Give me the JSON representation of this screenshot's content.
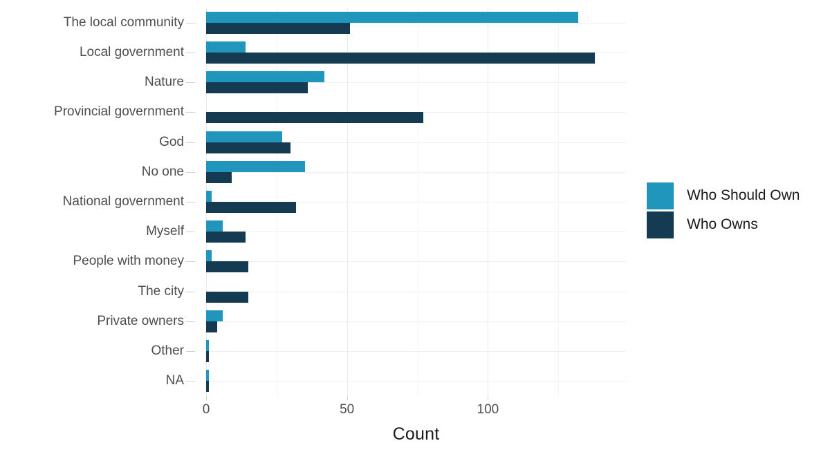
{
  "chart_data": {
    "type": "bar",
    "orientation": "horizontal",
    "title": "",
    "xlabel": "Count",
    "ylabel": "",
    "xlim": [
      0,
      149
    ],
    "xticks": [
      0,
      50,
      100
    ],
    "xtick_labels": [
      "0",
      "50",
      "100"
    ],
    "minor_gridlines": [
      25,
      75,
      125
    ],
    "grid": true,
    "legend_position": "right",
    "categories": [
      "The local community",
      "Local government",
      "Nature",
      "Provincial government",
      "God",
      "No one",
      "National government",
      "Myself",
      "People with money",
      "The city",
      "Private owners",
      "Other",
      "NA"
    ],
    "series": [
      {
        "name": "Who Should Own",
        "color": "#2196bd",
        "values": [
          132,
          14,
          42,
          0,
          27,
          35,
          2,
          6,
          2,
          0,
          6,
          1,
          1
        ]
      },
      {
        "name": "Who Owns",
        "color": "#143b52",
        "values": [
          51,
          138,
          36,
          77,
          30,
          9,
          32,
          14,
          15,
          15,
          4,
          1,
          1
        ]
      }
    ]
  },
  "legend": {
    "entries": [
      {
        "label": "Who Should Own",
        "color": "#2196bd"
      },
      {
        "label": "Who Owns",
        "color": "#143b52"
      }
    ]
  },
  "axis": {
    "x_title": "Count"
  }
}
